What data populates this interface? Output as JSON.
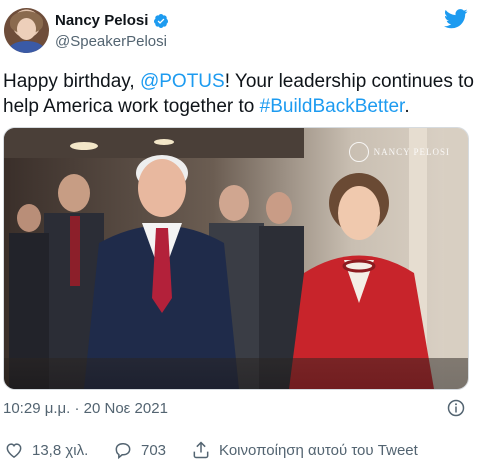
{
  "author": {
    "name": "Nancy Pelosi",
    "handle": "@SpeakerPelosi"
  },
  "tweet": {
    "text_before": "Happy birthday, ",
    "mention": "@POTUS",
    "text_middle": "! Your leadership continues to help America work together to ",
    "hashtag": "#BuildBackBetter",
    "text_end": "."
  },
  "photo": {
    "watermark": "NANCY PELOSI"
  },
  "meta": {
    "timestamp": "10:29 μ.μ. · 20 Νοε 2021"
  },
  "actions": {
    "likes": "13,8 χιλ.",
    "replies": "703",
    "share_label": "Κοινοποίηση αυτού του Tweet"
  },
  "colors": {
    "accent": "#1d9bf0",
    "text": "#0f1419",
    "secondary": "#536471",
    "verified": "#1d9bf0"
  },
  "icons": [
    "verified-badge-icon",
    "twitter-bird-icon",
    "info-icon",
    "heart-icon",
    "reply-icon",
    "share-icon"
  ]
}
